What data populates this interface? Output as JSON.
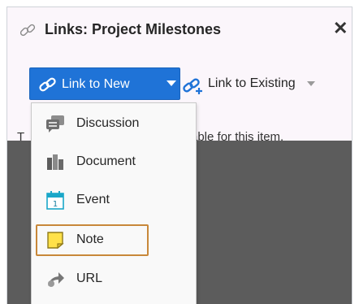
{
  "dialog": {
    "title": "Links: Project Milestones",
    "title_icon": "link-icon",
    "close_label": "✕"
  },
  "toolbar": {
    "link_new_label": "Link to New",
    "link_new_icon": "chain-link-icon",
    "link_existing_label": "Link to Existing",
    "link_existing_icon": "chain-plus-icon"
  },
  "body": {
    "message_start": "T",
    "message_end": "able for this item."
  },
  "menu": {
    "items": [
      {
        "label": "Discussion",
        "icon": "discussion-icon"
      },
      {
        "label": "Document",
        "icon": "document-icon"
      },
      {
        "label": "Event",
        "icon": "calendar-icon"
      },
      {
        "label": "Note",
        "icon": "note-icon",
        "highlighted": true
      },
      {
        "label": "URL",
        "icon": "url-icon"
      }
    ]
  },
  "colors": {
    "accent": "#1f73d7",
    "highlight_border": "#c8883a",
    "header_bg": "#fbf6fb",
    "overlay": "#5c5c5c"
  }
}
